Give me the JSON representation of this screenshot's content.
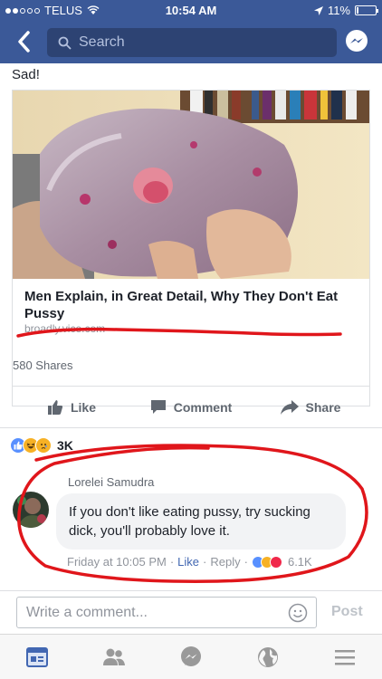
{
  "status": {
    "carrier": "TELUS",
    "time": "10:54 AM",
    "battery": "11%",
    "battery_level": 0.11
  },
  "nav": {
    "search_placeholder": "Search",
    "back_icon": "chevron-left-icon",
    "messenger_icon": "messenger-icon"
  },
  "post": {
    "caption": "Sad!",
    "link_title": "Men Explain, in Great Detail, Why They Don't Eat Pussy",
    "link_domain": "broadly.vice.com",
    "shares": "580 Shares",
    "actions": {
      "like": "Like",
      "comment": "Comment",
      "share": "Share"
    },
    "reaction_count": "3K"
  },
  "comment": {
    "author": "Lorelei Samudra",
    "text": "If you don't like eating pussy, try sucking dick, you'll probably love it.",
    "time": "Friday at 10:05 PM",
    "like": "Like",
    "reply": "Reply",
    "reaction_count": "6.1K"
  },
  "composer": {
    "placeholder": "Write a comment...",
    "post": "Post"
  },
  "colors": {
    "facebook_blue": "#3b5998",
    "link_blue": "#4267b2",
    "marker_red": "#e0161b"
  }
}
